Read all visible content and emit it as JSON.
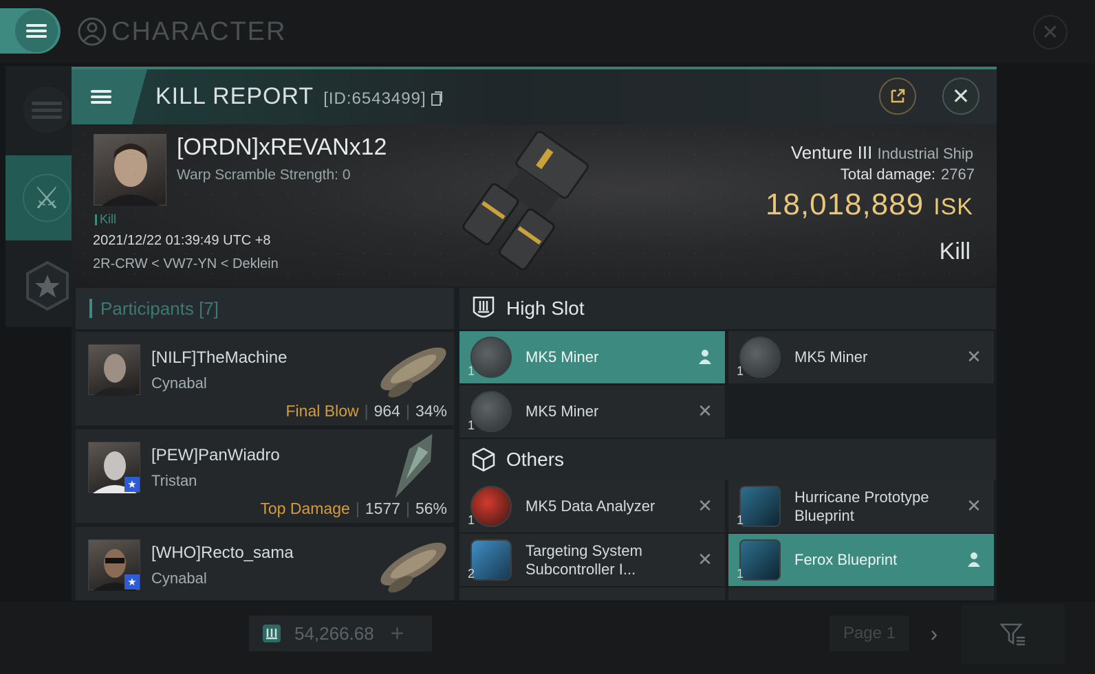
{
  "app": {
    "title": "CHARACTER",
    "wallet": "54,266.68",
    "page_label": "Page 1"
  },
  "window": {
    "title": "KILL REPORT",
    "id": "[ID:6543499]"
  },
  "victim": {
    "name": "[ORDN]xREVANx12",
    "warp_scramble": "Warp Scramble Strength: 0",
    "tag": "Kill",
    "datetime": "2021/12/22 01:39:49 UTC +8",
    "location": "2R-CRW < VW7-YN < Deklein",
    "ship": "Venture III",
    "ship_class": "Industrial Ship",
    "total_damage_label": "Total damage:",
    "total_damage": "2767",
    "isk_value": "18,018,889",
    "isk_unit": "ISK",
    "result": "Kill"
  },
  "participants": {
    "header": "Participants [7]",
    "items": [
      {
        "name": "[NILF]TheMachine",
        "ship": "Cynabal",
        "label": "Final Blow",
        "damage": "964",
        "percent": "34%",
        "badge": false
      },
      {
        "name": "[PEW]PanWiadro",
        "ship": "Tristan",
        "label": "Top Damage",
        "damage": "1577",
        "percent": "56%",
        "badge": true
      },
      {
        "name": "[WHO]Recto_sama",
        "ship": "Cynabal",
        "label": "",
        "damage": "",
        "percent": "",
        "badge": true
      }
    ]
  },
  "high_slot": {
    "header": "High Slot",
    "items": [
      {
        "name": "MK5 Miner",
        "qty": "1",
        "state": "person-icon",
        "active": true
      },
      {
        "name": "MK5 Miner",
        "qty": "1",
        "state": "close-icon",
        "active": false
      },
      {
        "name": "MK5 Miner",
        "qty": "1",
        "state": "close-icon",
        "active": false
      }
    ]
  },
  "others": {
    "header": "Others",
    "items": [
      {
        "name": "MK5 Data Analyzer",
        "qty": "1",
        "state": "close-icon",
        "active": false
      },
      {
        "name": "Hurricane Prototype Blueprint",
        "qty": "1",
        "state": "close-icon",
        "active": false
      },
      {
        "name": "Targeting System Subcontroller I...",
        "qty": "2",
        "state": "close-icon",
        "active": false
      },
      {
        "name": "Ferox Blueprint",
        "qty": "1",
        "state": "person-icon",
        "active": true
      }
    ]
  },
  "colors": {
    "accent": "#3c8a80",
    "isk": "#e8c779",
    "label": "#d39c3d"
  }
}
